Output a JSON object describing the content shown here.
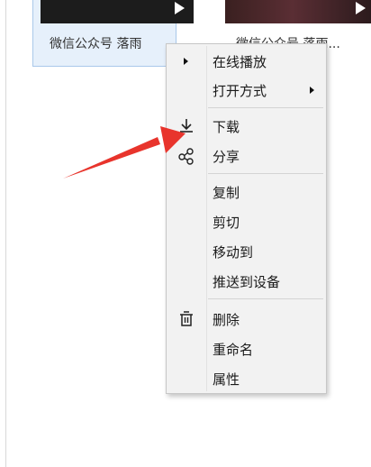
{
  "files": [
    {
      "label": "微信公众号 落雨",
      "selected": true
    },
    {
      "label": "微信公众号 落雨...",
      "selected": false
    }
  ],
  "context_menu": {
    "items": {
      "play_online": "在线播放",
      "open_with": "打开方式",
      "download": "下载",
      "share": "分享",
      "copy": "复制",
      "cut": "剪切",
      "move_to": "移动到",
      "push_to_device": "推送到设备",
      "delete": "删除",
      "rename": "重命名",
      "properties": "属性"
    }
  },
  "icons": {
    "play": "triangle-right",
    "download": "download-arrow",
    "share": "share-nodes",
    "delete": "trash",
    "submenu": "chevron-right"
  },
  "colors": {
    "annotation_arrow": "#e8342c",
    "selection_bg": "#e6f0fb",
    "selection_border": "#a9c8ea",
    "menu_bg": "#f2f2f2"
  }
}
